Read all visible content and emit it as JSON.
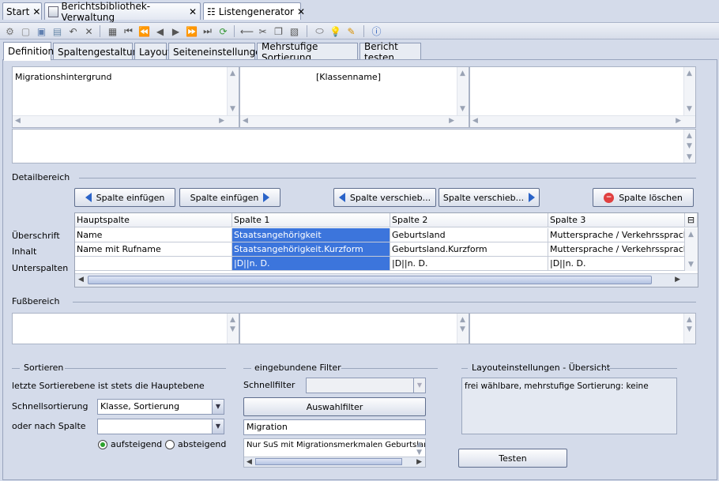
{
  "doc_tabs": [
    {
      "label": "Start"
    },
    {
      "label": "Berichtsbibliothek-Verwaltung"
    },
    {
      "label": "Listengenerator"
    }
  ],
  "sub_tabs": [
    {
      "label": "Definition"
    },
    {
      "label": "Spaltengestaltung"
    },
    {
      "label": "Layout"
    },
    {
      "label": "Seiteneinstellungen"
    },
    {
      "label": "Mehrstufige Sortierung"
    },
    {
      "label": "Bericht testen"
    }
  ],
  "header_cells": {
    "left": "Migrationshintergrund",
    "center": "[Klassenname]",
    "right": ""
  },
  "detail": {
    "title": "Detailbereich",
    "btn_insert_left": "Spalte einfügen",
    "btn_insert_right": "Spalte einfügen",
    "btn_move_left": "Spalte verschieb...",
    "btn_move_right": "Spalte verschieb...",
    "btn_delete": "Spalte löschen",
    "row_labels": [
      "Überschrift",
      "Inhalt",
      "Unterspalten"
    ],
    "columns": [
      "Hauptspalte",
      "Spalte 1",
      "Spalte 2",
      "Spalte 3"
    ],
    "rows": [
      [
        "Name",
        "Staatsangehörigkeit",
        "Geburtsland",
        "Muttersprache / Verkehrssprache"
      ],
      [
        "Name mit Rufname",
        "Staatsangehörigkeit.Kurzform",
        "Geburtsland.Kurzform",
        "Muttersprache / Verkehrssprache."
      ],
      [
        "",
        "|D||n. D.",
        "|D||n. D.",
        "|D||n. D."
      ]
    ]
  },
  "footer": {
    "title": "Fußbereich"
  },
  "sort": {
    "title": "Sortieren",
    "note": "letzte Sortierebene ist stets die Hauptebene",
    "quick_label": "Schnellsortierung",
    "quick_value": "Klasse, Sortierung",
    "by_column_label": "oder nach Spalte",
    "by_column_value": "",
    "asc_label": "aufsteigend",
    "desc_label": "absteigend"
  },
  "filter": {
    "title": "eingebundene Filter",
    "quick_label": "Schnellfilter",
    "quick_value": "",
    "select_button": "Auswahlfilter",
    "filter_name": "Migration",
    "filter_text": "Nur SuS mit Migrationsmerkmalen Geburtslan"
  },
  "layout_summary": {
    "title": "Layouteinstellungen - Übersicht",
    "text": "frei wählbare, mehrstufige Sortierung: keine",
    "test_button": "Testen"
  }
}
